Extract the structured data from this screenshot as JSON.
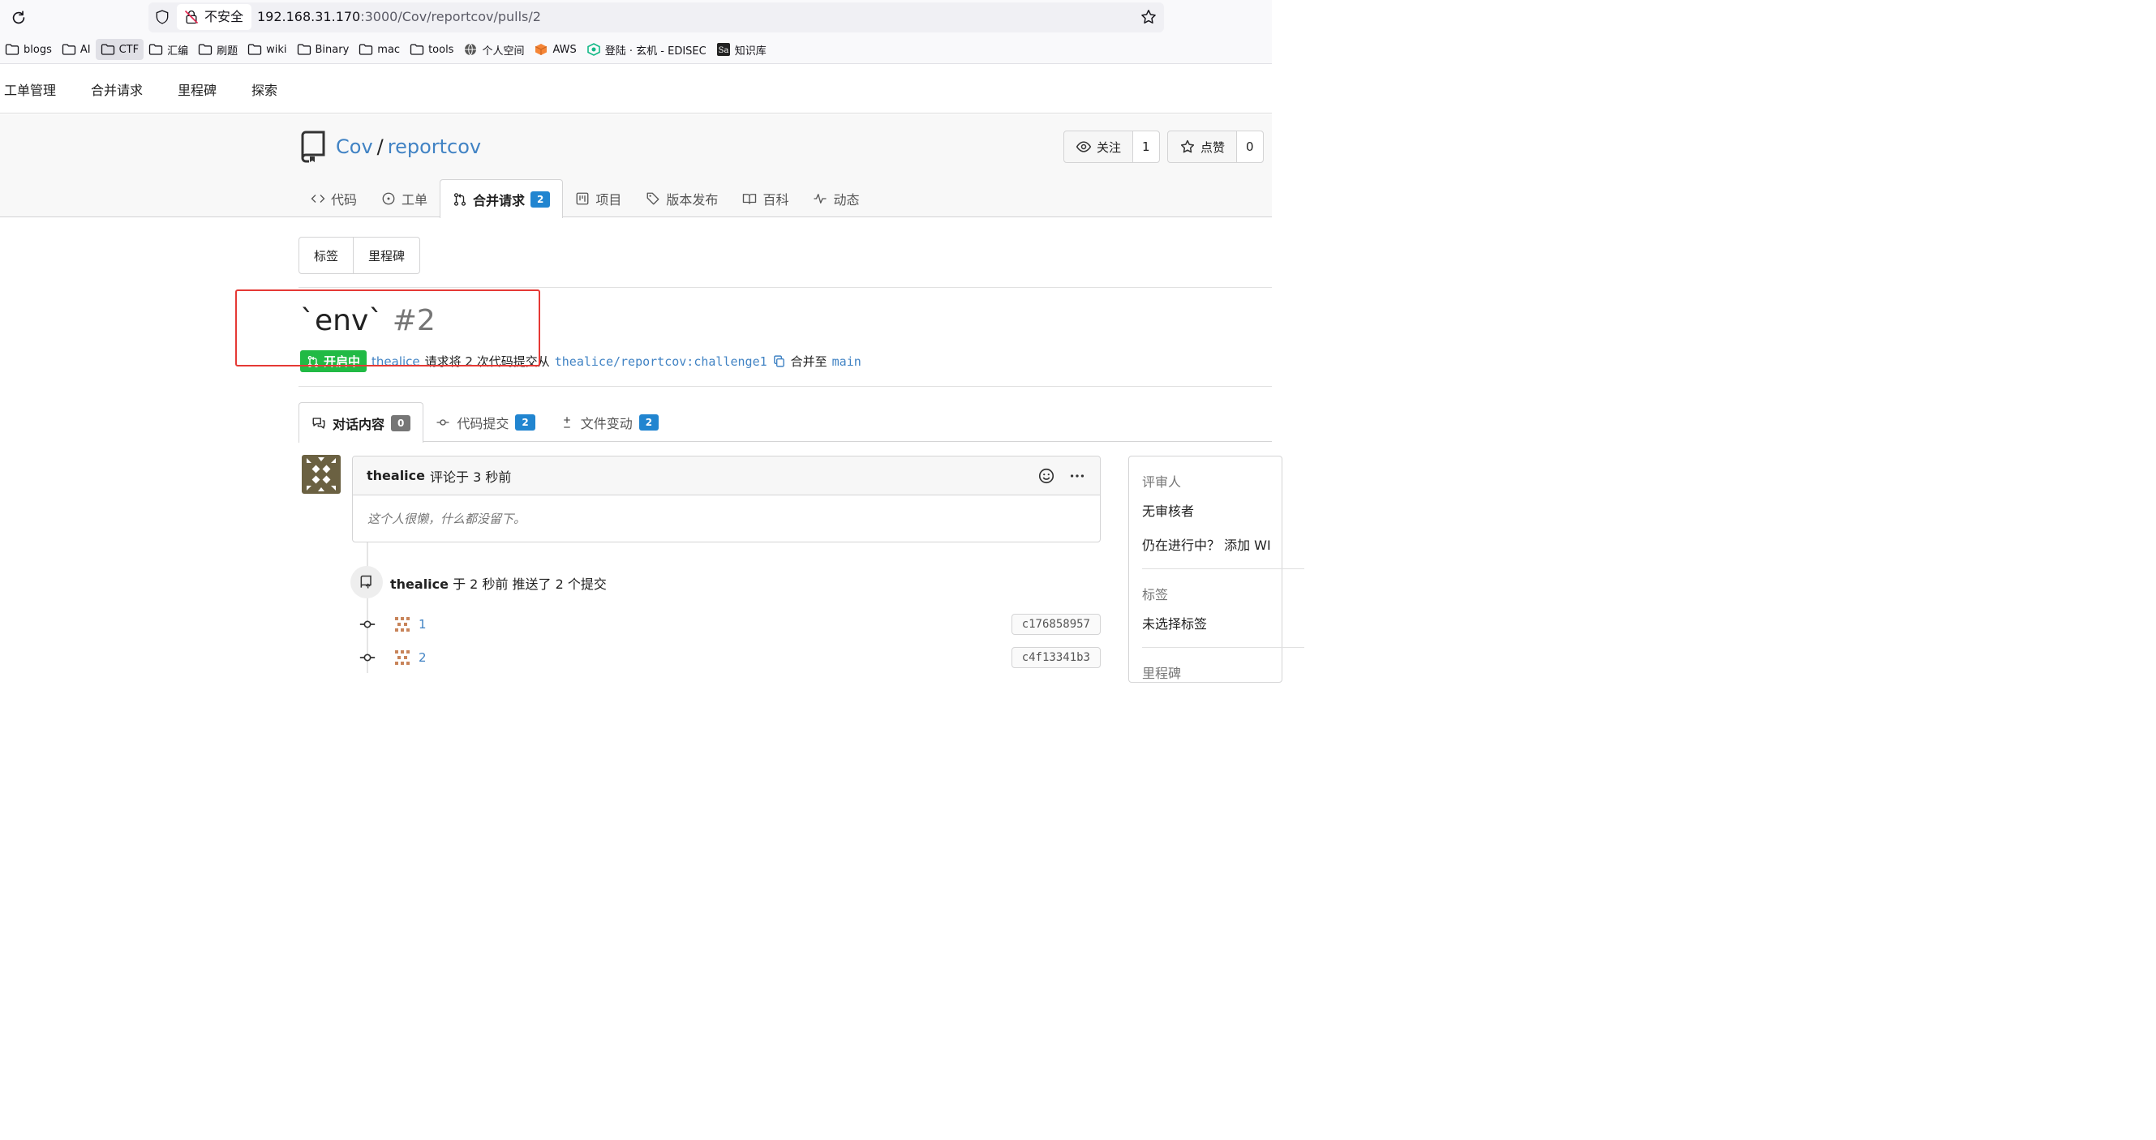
{
  "browser": {
    "security_label": "不安全",
    "url_host": "192.168.31.170",
    "url_path": ":3000/Cov/reportcov/pulls/2",
    "bookmarks": [
      {
        "label": "blogs",
        "icon": "folder-icon"
      },
      {
        "label": "AI",
        "icon": "folder-icon"
      },
      {
        "label": "CTF",
        "icon": "folder-icon"
      },
      {
        "label": "汇编",
        "icon": "folder-icon"
      },
      {
        "label": "刷题",
        "icon": "folder-icon"
      },
      {
        "label": "wiki",
        "icon": "folder-icon"
      },
      {
        "label": "Binary",
        "icon": "folder-icon"
      },
      {
        "label": "mac",
        "icon": "folder-icon"
      },
      {
        "label": "tools",
        "icon": "folder-icon"
      },
      {
        "label": "个人空间",
        "icon": "globe-icon"
      },
      {
        "label": "AWS",
        "icon": "aws-icon"
      },
      {
        "label": "登陆 · 玄机 - EDISEC",
        "icon": "edisec-icon"
      },
      {
        "label": "知识库",
        "icon": "sa-icon"
      }
    ],
    "active_bookmark": "CTF"
  },
  "site_nav": [
    "工单管理",
    "合并请求",
    "里程碑",
    "探索"
  ],
  "repo": {
    "owner": "Cov",
    "name": "reportcov",
    "watch_label": "关注",
    "watch_count": "1",
    "star_label": "点赞",
    "star_count": "0",
    "tabs": [
      {
        "label": "代码",
        "icon": "code-icon"
      },
      {
        "label": "工单",
        "icon": "issue-icon"
      },
      {
        "label": "合并请求",
        "icon": "pull-request-icon",
        "badge": "2",
        "active": true
      },
      {
        "label": "项目",
        "icon": "project-icon"
      },
      {
        "label": "版本发布",
        "icon": "tag-icon"
      },
      {
        "label": "百科",
        "icon": "book-icon"
      },
      {
        "label": "动态",
        "icon": "pulse-icon"
      }
    ]
  },
  "filters": {
    "labels": "标签",
    "milestones": "里程碑"
  },
  "pr": {
    "title": "`env`",
    "index": "#2",
    "state": "开启中",
    "author": "thealice",
    "desc_part1": "请求将 2 次代码提交从",
    "head_branch": "thealice/reportcov:challenge1",
    "desc_part2": "合并至",
    "base_branch": "main",
    "tabs": [
      {
        "label": "对话内容",
        "badge": "0",
        "icon": "comments-icon",
        "active": true
      },
      {
        "label": "代码提交",
        "badge": "2",
        "icon": "commit-icon"
      },
      {
        "label": "文件变动",
        "badge": "2",
        "icon": "diff-icon"
      }
    ]
  },
  "timeline": {
    "comment": {
      "author": "thealice",
      "meta": "评论于 3 秒前",
      "body": "这个人很懒，什么都没留下。"
    },
    "push": {
      "author": "thealice",
      "meta": "于 2 秒前 推送了 2 个提交"
    },
    "commits": [
      {
        "message": "1",
        "sha": "c176858957"
      },
      {
        "message": "2",
        "sha": "c4f13341b3"
      }
    ]
  },
  "sidebar": {
    "reviewers_heading": "评审人",
    "reviewers_value": "无审核者",
    "wip_text": "仍在进行中？ 添加 WI",
    "labels_heading": "标签",
    "labels_value": "未选择标签",
    "milestone_heading": "里程碑"
  },
  "colors": {
    "link": "#4183c4",
    "open": "#21ba45",
    "badge": "#2185d0",
    "highlight": "#e53935"
  }
}
